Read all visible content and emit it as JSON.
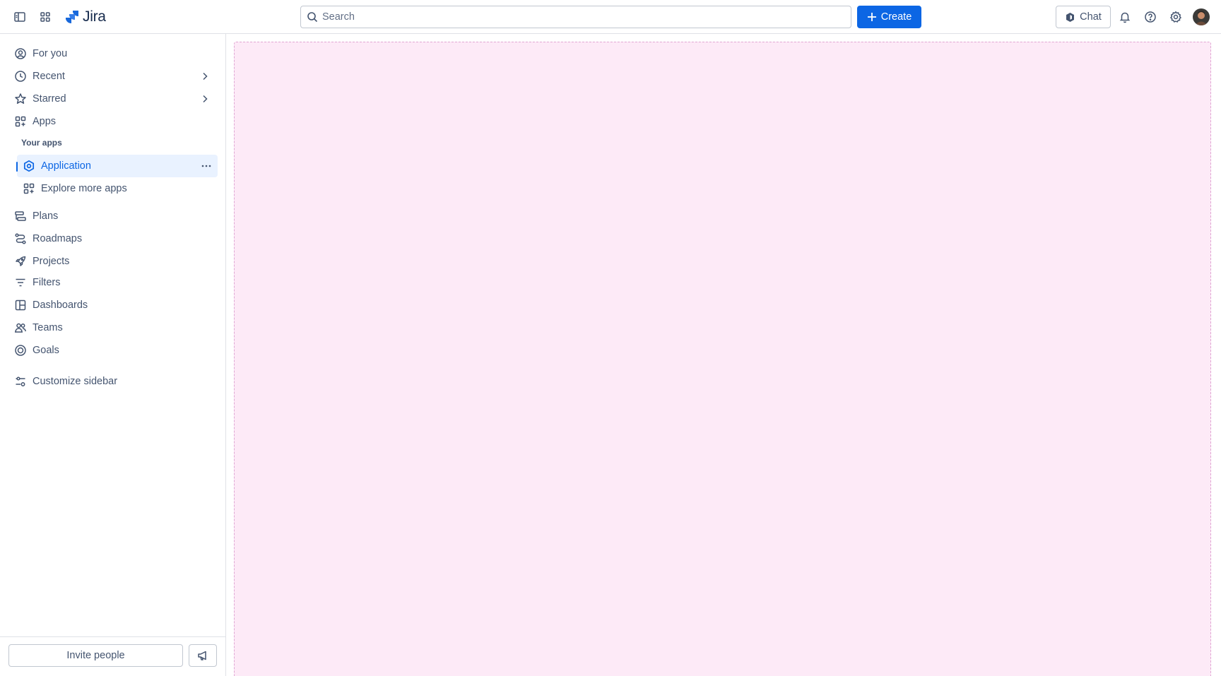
{
  "topbar": {
    "sidebar_toggle_icon": "sidebar-toggle-icon",
    "app_switcher_icon": "app-switcher-icon",
    "logo_text": "Jira",
    "search_placeholder": "Search",
    "create_label": "Create",
    "chat_label": "Chat",
    "notifications_icon": "bell-icon",
    "help_icon": "help-icon",
    "settings_icon": "gear-icon"
  },
  "sidebar": {
    "items": [
      {
        "label": "For you",
        "icon": "user-circle-icon"
      },
      {
        "label": "Recent",
        "icon": "clock-icon",
        "has_chevron": true
      },
      {
        "label": "Starred",
        "icon": "star-icon",
        "has_chevron": true
      },
      {
        "label": "Apps",
        "icon": "apps-icon"
      }
    ],
    "your_apps_label": "Your apps",
    "apps": [
      {
        "label": "Application",
        "icon": "hexagon-app-icon",
        "selected": true
      },
      {
        "label": "Explore more apps",
        "icon": "apps-add-icon"
      }
    ],
    "lower_items": [
      {
        "label": "Plans",
        "icon": "plans-icon"
      },
      {
        "label": "Roadmaps",
        "icon": "roadmap-icon"
      },
      {
        "label": "Projects",
        "icon": "rocket-icon"
      },
      {
        "label": "Filters",
        "icon": "filter-icon"
      },
      {
        "label": "Dashboards",
        "icon": "dashboard-icon"
      },
      {
        "label": "Teams",
        "icon": "teams-icon"
      },
      {
        "label": "Goals",
        "icon": "goal-icon"
      }
    ],
    "customize_label": "Customize sidebar",
    "invite_label": "Invite people"
  },
  "colors": {
    "accent": "#0c66e4",
    "selected_bg": "#e9f2ff",
    "canvas_bg": "#fdeaf7",
    "canvas_border": "#e0a6d3"
  }
}
